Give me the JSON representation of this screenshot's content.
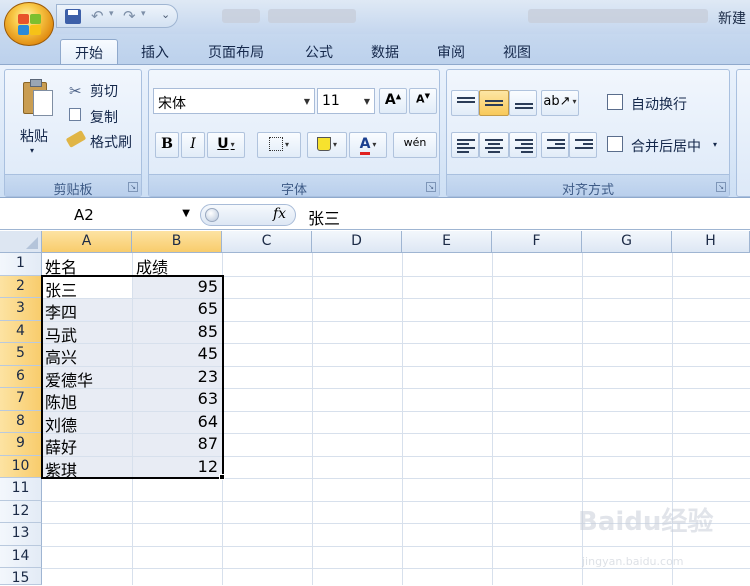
{
  "window": {
    "title": "新建"
  },
  "ribbon": {
    "tabs": [
      "开始",
      "插入",
      "页面布局",
      "公式",
      "数据",
      "审阅",
      "视图"
    ],
    "active_tab": "开始",
    "clipboard": {
      "paste": "粘贴",
      "cut": "剪切",
      "copy": "复制",
      "format_painter": "格式刷",
      "group_label": "剪贴板"
    },
    "font": {
      "font_name": "宋体",
      "font_size": "11",
      "bold": "B",
      "italic": "I",
      "underline": "U",
      "font_color_glyph": "A",
      "group_label": "字体"
    },
    "alignment": {
      "wrap_text": "自动换行",
      "merge_center": "合并后居中",
      "group_label": "对齐方式"
    }
  },
  "formula_bar": {
    "name_box": "A2",
    "fx": "fx",
    "content": "张三"
  },
  "sheet": {
    "columns": [
      "A",
      "B",
      "C",
      "D",
      "E",
      "F",
      "G",
      "H"
    ],
    "row_numbers": [
      "1",
      "2",
      "3",
      "4",
      "5",
      "6",
      "7",
      "8",
      "9",
      "10",
      "11",
      "12",
      "13",
      "14",
      "15"
    ],
    "header": {
      "name": "姓名",
      "score": "成绩"
    },
    "rows": [
      {
        "name": "张三",
        "score": "95"
      },
      {
        "name": "李四",
        "score": "65"
      },
      {
        "name": "马武",
        "score": "85"
      },
      {
        "name": "高兴",
        "score": "45"
      },
      {
        "name": "爱德华",
        "score": "23"
      },
      {
        "name": "陈旭",
        "score": "63"
      },
      {
        "name": "刘德",
        "score": "64"
      },
      {
        "name": "薛好",
        "score": "87"
      },
      {
        "name": "紫琪",
        "score": "12"
      }
    ]
  },
  "watermark": {
    "brand": "Baidu经验",
    "url": "jingyan.baidu.com"
  }
}
